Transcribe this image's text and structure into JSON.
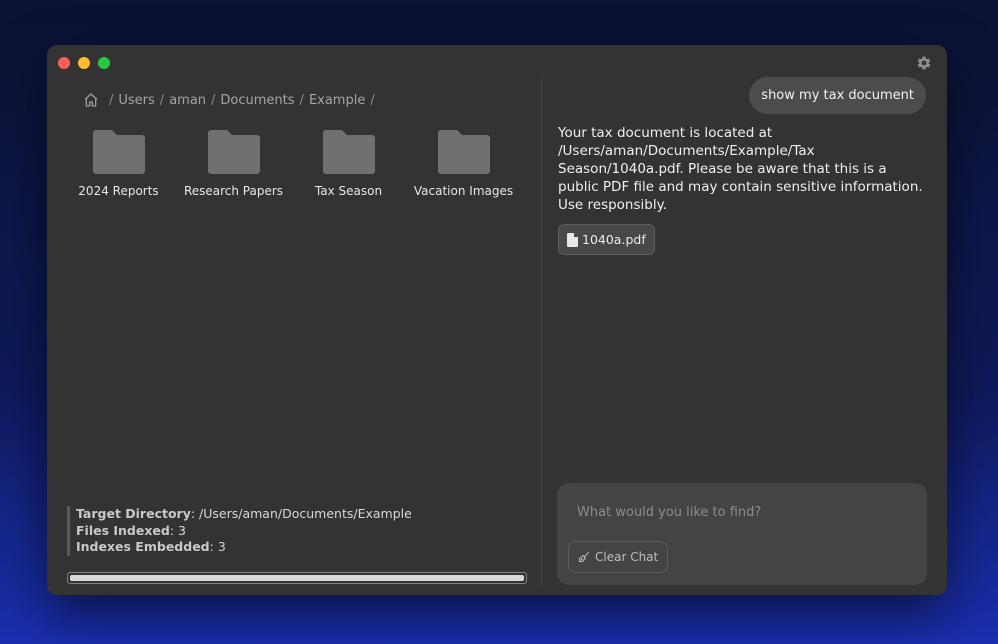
{
  "window": {
    "controls": {
      "close_color": "#fe5f57",
      "minimize_color": "#febc2e",
      "zoom_color": "#28c840"
    },
    "settings_icon": "gear-icon"
  },
  "breadcrumb": {
    "home_icon": "home-icon",
    "separator": "/",
    "items": [
      "Users",
      "aman",
      "Documents",
      "Example"
    ]
  },
  "folders": [
    {
      "name": "2024 Reports",
      "icon": "folder-icon"
    },
    {
      "name": "Research Papers",
      "icon": "folder-icon"
    },
    {
      "name": "Tax Season",
      "icon": "folder-icon"
    },
    {
      "name": "Vacation Images",
      "icon": "folder-icon"
    }
  ],
  "status": {
    "target_label": "Target Directory",
    "target_value": "/Users/aman/Documents/Example",
    "files_label": "Files Indexed",
    "files_value": "3",
    "embedded_label": "Indexes Embedded",
    "embedded_value": "3",
    "progress": 1.0
  },
  "chat": {
    "user_message": "show my tax document",
    "assistant_message": "Your tax document is located at /Users/aman/Documents/Example/Tax Season/1040a.pdf. Please be aware that this is a public PDF file and may contain sensitive information. Use responsibly.",
    "attachment": {
      "name": "1040a.pdf",
      "icon": "document-icon"
    },
    "input_placeholder": "What would you like to find?",
    "input_value": "",
    "clear_label": "Clear Chat",
    "clear_icon": "broom-icon"
  }
}
